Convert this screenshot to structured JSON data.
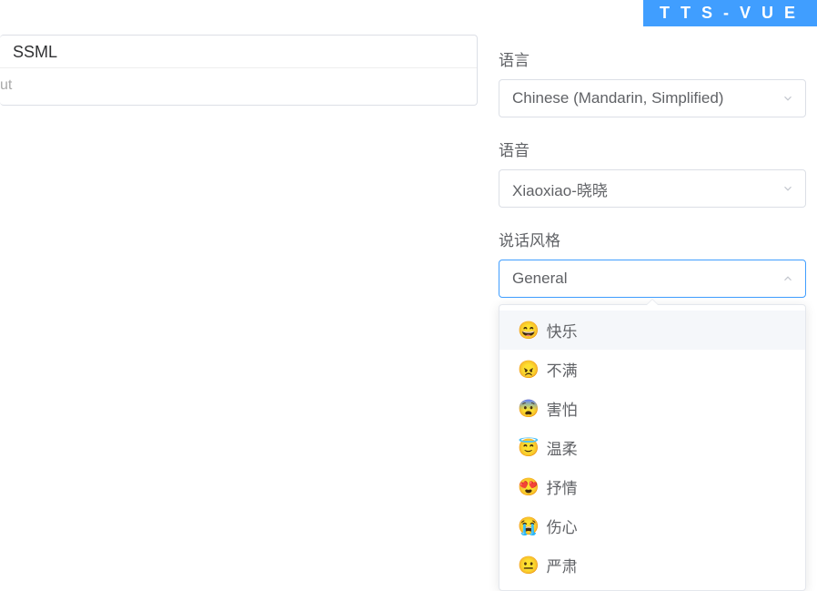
{
  "brand": "TTS-VUE",
  "left": {
    "header": "SSML",
    "placeholder_suffix": "ut"
  },
  "right": {
    "language": {
      "label": "语言",
      "value": "Chinese (Mandarin, Simplified)"
    },
    "voice": {
      "label": "语音",
      "value": "Xiaoxiao-晓晓"
    },
    "style": {
      "label": "说话风格",
      "value": "General"
    }
  },
  "styleOptions": [
    {
      "emoji": "😄",
      "label": "快乐"
    },
    {
      "emoji": "😠",
      "label": "不满"
    },
    {
      "emoji": "😨",
      "label": "害怕"
    },
    {
      "emoji": "😇",
      "label": "温柔"
    },
    {
      "emoji": "😍",
      "label": "抒情"
    },
    {
      "emoji": "😭",
      "label": "伤心"
    },
    {
      "emoji": "😐",
      "label": "严肃"
    }
  ]
}
